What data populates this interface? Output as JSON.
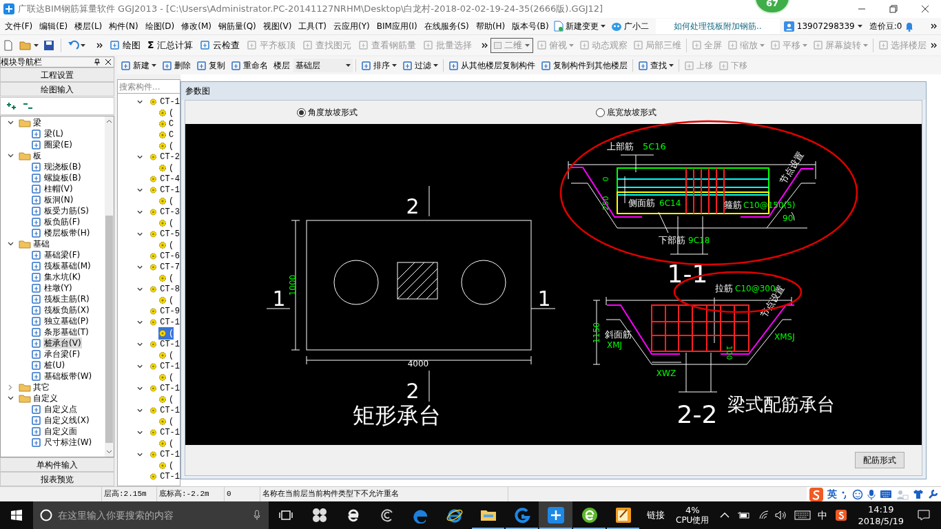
{
  "window": {
    "title": "广联达BIM钢筋算量软件 GGJ2013 - [C:\\Users\\Administrator.PC-20141127NRHM\\Desktop\\白龙村-2018-02-02-19-24-35(2666版).GGJ12]",
    "badge": "67"
  },
  "menu_bar": {
    "items": [
      "文件(F)",
      "编辑(E)",
      "楼层(L)",
      "构件(N)",
      "绘图(D)",
      "修改(M)",
      "钢筋量(Q)",
      "视图(V)",
      "工具(T)",
      "云应用(Y)",
      "BIM应用(I)",
      "在线服务(S)",
      "帮助(H)",
      "版本号(B)"
    ],
    "new_change": "新建变更",
    "assistant": "广小二",
    "help_link": "如何处理筏板附加钢筋..",
    "account": "13907298339",
    "credits": "造价豆:0"
  },
  "toolbar": {
    "items": [
      {
        "label": "绘图",
        "disabled": false
      },
      {
        "label": "汇总计算",
        "disabled": false,
        "icon_text": "Σ"
      },
      {
        "label": "云检查",
        "disabled": false
      },
      {
        "label": "平齐板顶",
        "disabled": true
      },
      {
        "label": "查找图元",
        "disabled": true
      },
      {
        "label": "查看钢筋量",
        "disabled": true
      },
      {
        "label": "批量选择",
        "disabled": true
      }
    ],
    "view_mode": "二维",
    "view_items": [
      {
        "label": "俯视",
        "disabled": true,
        "dropdown": true
      },
      {
        "label": "动态观察",
        "disabled": true,
        "dropdown": false
      },
      {
        "label": "局部三维",
        "disabled": true,
        "dropdown": false
      },
      {
        "label": "全屏",
        "disabled": true,
        "dropdown": false
      },
      {
        "label": "缩放",
        "disabled": true,
        "dropdown": true
      },
      {
        "label": "平移",
        "disabled": true,
        "dropdown": true
      },
      {
        "label": "屏幕旋转",
        "disabled": true,
        "dropdown": true
      },
      {
        "label": "选择楼层",
        "disabled": true,
        "dropdown": false
      }
    ]
  },
  "nav_panel": {
    "title": "模块导航栏",
    "top_sections": [
      "工程设置",
      "绘图输入"
    ],
    "tree": [
      {
        "label": "梁",
        "expanded": true,
        "children": [
          {
            "label": "梁(L)",
            "selected": false
          },
          {
            "label": "圈梁(E)",
            "selected": false
          }
        ]
      },
      {
        "label": "板",
        "expanded": true,
        "children": [
          {
            "label": "现浇板(B)",
            "selected": false
          },
          {
            "label": "螺旋板(B)",
            "selected": false
          },
          {
            "label": "柱帽(V)",
            "selected": false
          },
          {
            "label": "板洞(N)",
            "selected": false
          },
          {
            "label": "板受力筋(S)",
            "selected": false
          },
          {
            "label": "板负筋(F)",
            "selected": false
          },
          {
            "label": "楼层板带(H)",
            "selected": false
          }
        ]
      },
      {
        "label": "基础",
        "expanded": true,
        "children": [
          {
            "label": "基础梁(F)",
            "selected": false
          },
          {
            "label": "筏板基础(M)",
            "selected": false
          },
          {
            "label": "集水坑(K)",
            "selected": false
          },
          {
            "label": "柱墩(Y)",
            "selected": false
          },
          {
            "label": "筏板主筋(R)",
            "selected": false
          },
          {
            "label": "筏板负筋(X)",
            "selected": false
          },
          {
            "label": "独立基础(P)",
            "selected": false
          },
          {
            "label": "条形基础(T)",
            "selected": false
          },
          {
            "label": "桩承台(V)",
            "selected": true
          },
          {
            "label": "承台梁(F)",
            "selected": false
          },
          {
            "label": "桩(U)",
            "selected": false
          },
          {
            "label": "基础板带(W)",
            "selected": false
          }
        ]
      },
      {
        "label": "其它",
        "expanded": false
      },
      {
        "label": "自定义",
        "expanded": true,
        "children": [
          {
            "label": "自定义点",
            "selected": false
          },
          {
            "label": "自定义线(X)",
            "selected": false
          },
          {
            "label": "自定义面",
            "selected": false
          },
          {
            "label": "尺寸标注(W)",
            "selected": false
          }
        ]
      }
    ],
    "bottom_sections": [
      "单构件输入",
      "报表预览"
    ]
  },
  "component_toolbar": {
    "items": [
      {
        "label": "新建",
        "disabled": false,
        "dropdown": true
      },
      {
        "label": "删除",
        "disabled": false,
        "dropdown": false
      },
      {
        "label": "复制",
        "disabled": false,
        "dropdown": false
      },
      {
        "label": "重命名",
        "disabled": false,
        "dropdown": false
      }
    ],
    "floor_label": "楼层",
    "floor_value": "基础层",
    "more_items": [
      {
        "label": "排序",
        "disabled": false,
        "dropdown": true
      },
      {
        "label": "过滤",
        "disabled": false,
        "dropdown": true
      },
      {
        "label": "从其他楼层复制构件",
        "disabled": false,
        "dropdown": false
      },
      {
        "label": "复制构件到其他楼层",
        "disabled": false,
        "dropdown": false
      },
      {
        "label": "查找",
        "disabled": false,
        "dropdown": true
      },
      {
        "label": "上移",
        "disabled": true,
        "dropdown": false
      },
      {
        "label": "下移",
        "disabled": true,
        "dropdown": false
      }
    ]
  },
  "component_list": {
    "placeholder": "搜索构件...",
    "items": [
      {
        "label": "CT-1",
        "expanded": true,
        "selected": false,
        "children": [
          {
            "label": "(",
            "selected": false
          },
          {
            "label": "C",
            "selected": false
          },
          {
            "label": "C",
            "selected": false
          },
          {
            "label": "(",
            "selected": false
          }
        ]
      },
      {
        "label": "CT-2",
        "expanded": true,
        "selected": false,
        "children": [
          {
            "label": "(",
            "selected": false
          }
        ]
      },
      {
        "label": "CT-4",
        "expanded": false,
        "selected": false
      },
      {
        "label": "CT-1",
        "expanded": true,
        "selected": false,
        "children": [
          {
            "label": "(",
            "selected": false
          }
        ]
      },
      {
        "label": "CT-3",
        "expanded": true,
        "selected": false,
        "children": [
          {
            "label": "(",
            "selected": false
          }
        ]
      },
      {
        "label": "CT-5",
        "expanded": true,
        "selected": false,
        "children": [
          {
            "label": "(",
            "selected": false
          }
        ]
      },
      {
        "label": "CT-6",
        "expanded": false,
        "selected": false
      },
      {
        "label": "CT-7",
        "expanded": true,
        "selected": false,
        "children": [
          {
            "label": "(",
            "selected": false
          }
        ]
      },
      {
        "label": "CT-8",
        "expanded": true,
        "selected": false,
        "children": [
          {
            "label": "(",
            "selected": false
          }
        ]
      },
      {
        "label": "CT-9",
        "expanded": false,
        "selected": false
      },
      {
        "label": "CT-1",
        "expanded": true,
        "selected": false,
        "children": [
          {
            "label": "(",
            "selected": true
          }
        ]
      },
      {
        "label": "CT-1",
        "expanded": true,
        "selected": false,
        "children": [
          {
            "label": "(",
            "selected": false
          }
        ]
      },
      {
        "label": "CT-1",
        "expanded": true,
        "selected": false,
        "children": [
          {
            "label": "(",
            "selected": false
          }
        ]
      },
      {
        "label": "CT-1",
        "expanded": true,
        "selected": false,
        "children": [
          {
            "label": "(",
            "selected": false
          }
        ]
      },
      {
        "label": "CT-1",
        "expanded": true,
        "selected": false,
        "children": [
          {
            "label": "(",
            "selected": false
          }
        ]
      },
      {
        "label": "CT-1",
        "expanded": true,
        "selected": false,
        "children": [
          {
            "label": "(",
            "selected": false
          }
        ]
      },
      {
        "label": "CT-1",
        "expanded": true,
        "selected": false,
        "children": [
          {
            "label": "(",
            "selected": false
          }
        ]
      },
      {
        "label": "CT-1",
        "expanded": false,
        "selected": false
      }
    ]
  },
  "dialog": {
    "title": "参数图",
    "options": [
      {
        "label": "角度放坡形式",
        "selected": true
      },
      {
        "label": "底宽放坡形式",
        "selected": false
      }
    ],
    "plan_labels": [
      "2",
      "1000",
      "1",
      "1",
      "4000",
      "2",
      "矩形承台"
    ],
    "section_1_labels": [
      "上部筋",
      "5C16",
      "0",
      "250",
      "侧面筋",
      "6C14",
      "箍筋",
      "C10@150(5)",
      "90",
      "下部筋",
      "9C18",
      "节点设置",
      "1-1"
    ],
    "section_2_labels": [
      "拉筋",
      "C10@300",
      "节点设置",
      "1150",
      "斜面筋",
      "XMJ",
      "XMSJ",
      "XWZ",
      "100",
      "2-2",
      "梁式配筋承台"
    ],
    "button": "配筋形式"
  },
  "status_bar": [
    "层高:2.15m",
    "底标高:-2.2m",
    "0",
    "名称在当前层当前构件类型下不允许重名"
  ],
  "ime_bar": {
    "mode": "英"
  },
  "taskbar": {
    "search_placeholder": "在这里输入你要搜索的内容",
    "network": "链接",
    "cpu_value": "4%",
    "cpu_label": "CPU使用",
    "input_mode": "中",
    "time": "14:19",
    "date": "2018/5/19"
  }
}
